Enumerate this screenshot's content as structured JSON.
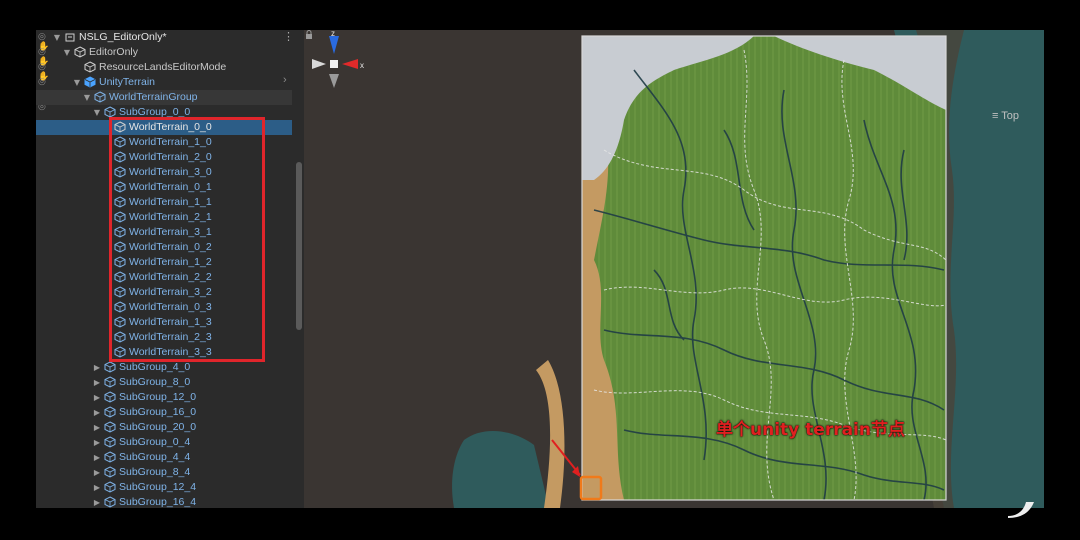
{
  "hierarchy": {
    "rows": [
      {
        "label": "NSLG_EditorOnly*",
        "depth": 0,
        "arrow": "▼",
        "kind": "scene",
        "style": "white"
      },
      {
        "label": "EditorOnly",
        "depth": 1,
        "arrow": "▼",
        "kind": "cube",
        "style": ""
      },
      {
        "label": "ResourceLandsEditorMode",
        "depth": 2,
        "arrow": "",
        "kind": "cube",
        "style": ""
      },
      {
        "label": "UnityTerrain",
        "depth": 2,
        "arrow": "▼",
        "kind": "cube-blue",
        "style": "blue"
      },
      {
        "label": "WorldTerrainGroup",
        "depth": 3,
        "arrow": "▼",
        "kind": "cube",
        "style": "blue",
        "dim": true
      },
      {
        "label": "SubGroup_0_0",
        "depth": 4,
        "arrow": "▼",
        "kind": "cube",
        "style": "blue"
      },
      {
        "label": "WorldTerrain_0_0",
        "depth": 5,
        "arrow": "",
        "kind": "cube",
        "style": "white",
        "selected": true
      },
      {
        "label": "WorldTerrain_1_0",
        "depth": 5,
        "arrow": "",
        "kind": "cube",
        "style": "blue"
      },
      {
        "label": "WorldTerrain_2_0",
        "depth": 5,
        "arrow": "",
        "kind": "cube",
        "style": "blue"
      },
      {
        "label": "WorldTerrain_3_0",
        "depth": 5,
        "arrow": "",
        "kind": "cube",
        "style": "blue"
      },
      {
        "label": "WorldTerrain_0_1",
        "depth": 5,
        "arrow": "",
        "kind": "cube",
        "style": "blue"
      },
      {
        "label": "WorldTerrain_1_1",
        "depth": 5,
        "arrow": "",
        "kind": "cube",
        "style": "blue"
      },
      {
        "label": "WorldTerrain_2_1",
        "depth": 5,
        "arrow": "",
        "kind": "cube",
        "style": "blue"
      },
      {
        "label": "WorldTerrain_3_1",
        "depth": 5,
        "arrow": "",
        "kind": "cube",
        "style": "blue"
      },
      {
        "label": "WorldTerrain_0_2",
        "depth": 5,
        "arrow": "",
        "kind": "cube",
        "style": "blue"
      },
      {
        "label": "WorldTerrain_1_2",
        "depth": 5,
        "arrow": "",
        "kind": "cube",
        "style": "blue"
      },
      {
        "label": "WorldTerrain_2_2",
        "depth": 5,
        "arrow": "",
        "kind": "cube",
        "style": "blue"
      },
      {
        "label": "WorldTerrain_3_2",
        "depth": 5,
        "arrow": "",
        "kind": "cube",
        "style": "blue"
      },
      {
        "label": "WorldTerrain_0_3",
        "depth": 5,
        "arrow": "",
        "kind": "cube",
        "style": "blue"
      },
      {
        "label": "WorldTerrain_1_3",
        "depth": 5,
        "arrow": "",
        "kind": "cube",
        "style": "blue"
      },
      {
        "label": "WorldTerrain_2_3",
        "depth": 5,
        "arrow": "",
        "kind": "cube",
        "style": "blue"
      },
      {
        "label": "WorldTerrain_3_3",
        "depth": 5,
        "arrow": "",
        "kind": "cube",
        "style": "blue"
      },
      {
        "label": "SubGroup_4_0",
        "depth": 4,
        "arrow": "▶",
        "kind": "cube",
        "style": "blue"
      },
      {
        "label": "SubGroup_8_0",
        "depth": 4,
        "arrow": "▶",
        "kind": "cube",
        "style": "blue"
      },
      {
        "label": "SubGroup_12_0",
        "depth": 4,
        "arrow": "▶",
        "kind": "cube",
        "style": "blue"
      },
      {
        "label": "SubGroup_16_0",
        "depth": 4,
        "arrow": "▶",
        "kind": "cube",
        "style": "blue"
      },
      {
        "label": "SubGroup_20_0",
        "depth": 4,
        "arrow": "▶",
        "kind": "cube",
        "style": "blue"
      },
      {
        "label": "SubGroup_0_4",
        "depth": 4,
        "arrow": "▶",
        "kind": "cube",
        "style": "blue"
      },
      {
        "label": "SubGroup_4_4",
        "depth": 4,
        "arrow": "▶",
        "kind": "cube",
        "style": "blue"
      },
      {
        "label": "SubGroup_8_4",
        "depth": 4,
        "arrow": "▶",
        "kind": "cube",
        "style": "blue"
      },
      {
        "label": "SubGroup_12_4",
        "depth": 4,
        "arrow": "▶",
        "kind": "cube",
        "style": "blue"
      },
      {
        "label": "SubGroup_16_4",
        "depth": 4,
        "arrow": "▶",
        "kind": "cube",
        "style": "blue"
      }
    ],
    "menu_icon": "kebab-menu-icon",
    "expand_icon": "chevron-right-icon"
  },
  "scene": {
    "gizmo": {
      "y_axis": "z",
      "x_axis": "x",
      "view_label": "≡ Top"
    },
    "annotation": "单个unity terrain节点"
  },
  "colors": {
    "selection": "#2c5d87",
    "highlight_box": "#e0252b",
    "terrain": "#5f8b3a",
    "water": "#2f5b5c",
    "sand": "#c49a62",
    "annotation": "#e02020"
  }
}
